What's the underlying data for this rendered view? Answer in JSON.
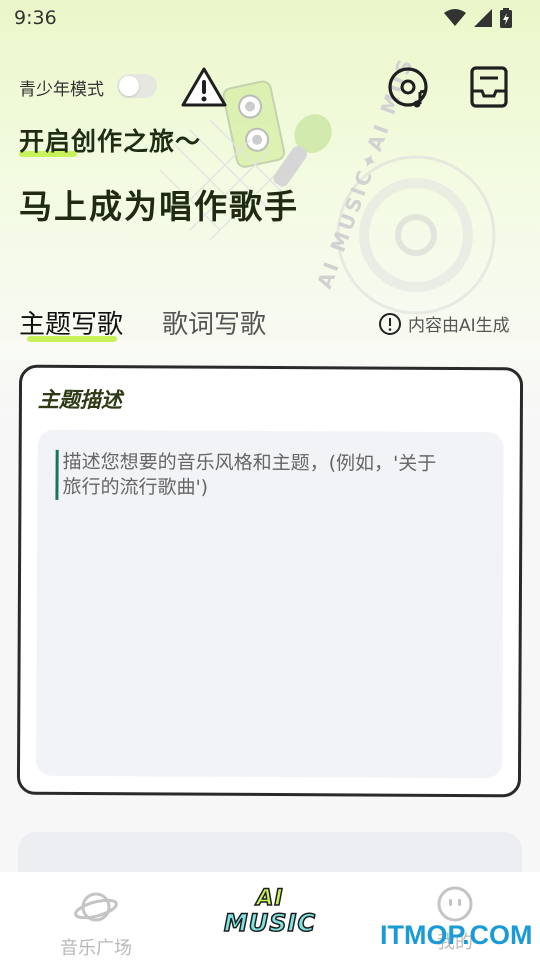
{
  "status_bar": {
    "time": "9:36"
  },
  "header": {
    "teen_mode_label": "青少年模式",
    "slogan_small": "开启创作之旅～",
    "slogan_big": "马上成为唱作歌手",
    "hero_ring_text": "AI MUSIC✦AI MUSIC✦AI MUSIC✦"
  },
  "tabs": {
    "theme_tab": "主题写歌",
    "lyrics_tab": "歌词写歌",
    "ai_note": "内容由AI生成"
  },
  "theme_card": {
    "title": "主题描述",
    "placeholder_line1": "描述您想要的音乐风格和主题，(例如，'关于",
    "placeholder_line2": "旅行的流行歌曲')"
  },
  "bottom_nav": {
    "plaza_label": "音乐广场",
    "ai_logo_top": "AI",
    "ai_logo_bottom": "MUSIC",
    "mine_label": "我的"
  },
  "watermark": "ITMOP.COM",
  "colors": {
    "accent_lime": "#c7f25a",
    "accent_cyan": "#7fe3e0",
    "watermark_blue": "#1a9bd7"
  }
}
